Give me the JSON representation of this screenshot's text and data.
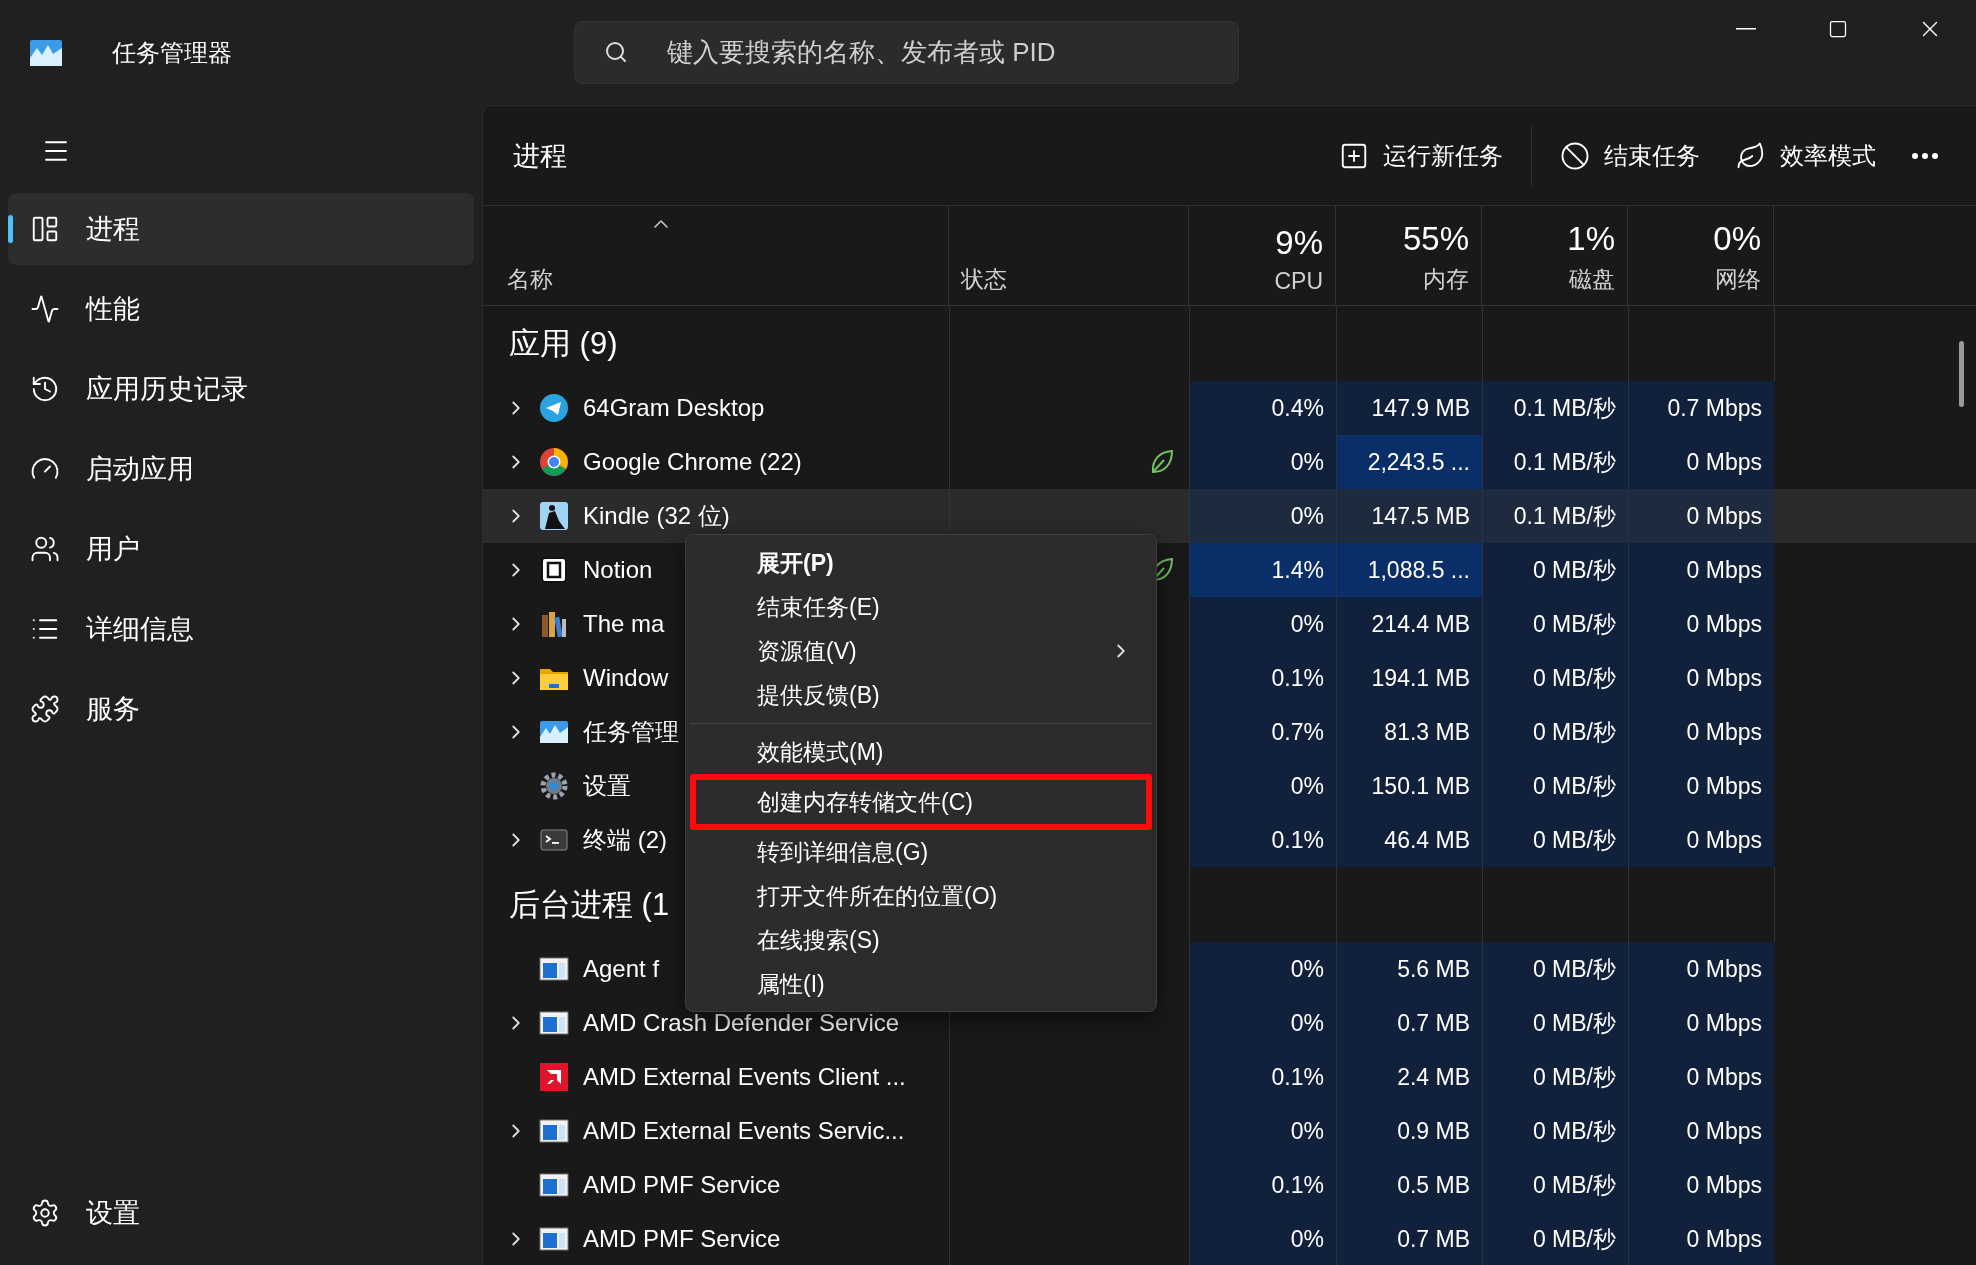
{
  "window": {
    "title": "任务管理器"
  },
  "search": {
    "placeholder": "键入要搜索的名称、发布者或 PID"
  },
  "sidebar": {
    "items": [
      {
        "label": "进程",
        "selected": true
      },
      {
        "label": "性能",
        "selected": false
      },
      {
        "label": "应用历史记录",
        "selected": false
      },
      {
        "label": "启动应用",
        "selected": false
      },
      {
        "label": "用户",
        "selected": false
      },
      {
        "label": "详细信息",
        "selected": false
      },
      {
        "label": "服务",
        "selected": false
      }
    ],
    "footer": {
      "label": "设置"
    }
  },
  "page": {
    "title": "进程",
    "actions": [
      {
        "label": "运行新任务"
      },
      {
        "label": "结束任务"
      },
      {
        "label": "效率模式"
      }
    ]
  },
  "table": {
    "name_column": {
      "label": "名称",
      "sorted": true
    },
    "status_column": {
      "label": "状态"
    },
    "metric_columns": [
      {
        "total": "9%",
        "label": "CPU"
      },
      {
        "total": "55%",
        "label": "内存"
      },
      {
        "total": "1%",
        "label": "磁盘"
      },
      {
        "total": "0%",
        "label": "网络"
      }
    ],
    "groups": [
      {
        "title": "应用 (9)",
        "rows": [
          {
            "name": "64Gram Desktop",
            "kind": "plane",
            "expandable": true,
            "efficiency": false,
            "hovered": false,
            "metrics": [
              {
                "value": "0.4%",
                "hot": false
              },
              {
                "value": "147.9 MB",
                "hot": false
              },
              {
                "value": "0.1 MB/秒",
                "hot": false
              },
              {
                "value": "0.7 Mbps",
                "hot": false
              }
            ]
          },
          {
            "name": "Google Chrome (22)",
            "kind": "wheel",
            "expandable": true,
            "efficiency": true,
            "hovered": false,
            "metrics": [
              {
                "value": "0%",
                "hot": false
              },
              {
                "value": "2,243.5 ...",
                "hot": true
              },
              {
                "value": "0.1 MB/秒",
                "hot": false
              },
              {
                "value": "0 Mbps",
                "hot": false
              }
            ]
          },
          {
            "name": "Kindle (32 位)",
            "kind": "reader",
            "expandable": true,
            "efficiency": false,
            "hovered": true,
            "metrics": [
              {
                "value": "0%",
                "hot": false
              },
              {
                "value": "147.5 MB",
                "hot": false
              },
              {
                "value": "0.1 MB/秒",
                "hot": false
              },
              {
                "value": "0 Mbps",
                "hot": false
              }
            ]
          },
          {
            "name": "Notion",
            "kind": "square",
            "expandable": true,
            "efficiency": true,
            "hovered": false,
            "metrics": [
              {
                "value": "1.4%",
                "hot": true
              },
              {
                "value": "1,088.5 ...",
                "hot": true
              },
              {
                "value": "0 MB/秒",
                "hot": false
              },
              {
                "value": "0 Mbps",
                "hot": false
              }
            ]
          },
          {
            "name": "The ma",
            "kind": "books",
            "expandable": true,
            "efficiency": false,
            "hovered": false,
            "metrics": [
              {
                "value": "0%",
                "hot": false
              },
              {
                "value": "214.4 MB",
                "hot": false
              },
              {
                "value": "0 MB/秒",
                "hot": false
              },
              {
                "value": "0 Mbps",
                "hot": false
              }
            ]
          },
          {
            "name": "Window",
            "kind": "folder",
            "expandable": true,
            "efficiency": false,
            "hovered": false,
            "metrics": [
              {
                "value": "0.1%",
                "hot": false
              },
              {
                "value": "194.1 MB",
                "hot": false
              },
              {
                "value": "0 MB/秒",
                "hot": false
              },
              {
                "value": "0 Mbps",
                "hot": false
              }
            ]
          },
          {
            "name": "任务管理",
            "kind": "chart",
            "expandable": true,
            "efficiency": false,
            "hovered": false,
            "metrics": [
              {
                "value": "0.7%",
                "hot": false
              },
              {
                "value": "81.3 MB",
                "hot": false
              },
              {
                "value": "0 MB/秒",
                "hot": false
              },
              {
                "value": "0 Mbps",
                "hot": false
              }
            ]
          },
          {
            "name": "设置",
            "kind": "gear",
            "expandable": false,
            "efficiency": false,
            "hovered": false,
            "metrics": [
              {
                "value": "0%",
                "hot": false
              },
              {
                "value": "150.1 MB",
                "hot": false
              },
              {
                "value": "0 MB/秒",
                "hot": false
              },
              {
                "value": "0 Mbps",
                "hot": false
              }
            ]
          },
          {
            "name": "终端 (2)",
            "kind": "terminal",
            "expandable": true,
            "efficiency": false,
            "hovered": false,
            "metrics": [
              {
                "value": "0.1%",
                "hot": false
              },
              {
                "value": "46.4 MB",
                "hot": false
              },
              {
                "value": "0 MB/秒",
                "hot": false
              },
              {
                "value": "0 Mbps",
                "hot": false
              }
            ]
          }
        ]
      },
      {
        "title": "后台进程 (1",
        "rows": [
          {
            "name": "Agent f",
            "kind": "window",
            "expandable": false,
            "efficiency": false,
            "hovered": false,
            "metrics": [
              {
                "value": "0%",
                "hot": false
              },
              {
                "value": "5.6 MB",
                "hot": false
              },
              {
                "value": "0 MB/秒",
                "hot": false
              },
              {
                "value": "0 Mbps",
                "hot": false
              }
            ]
          },
          {
            "name": "AMD Crash Defender Service",
            "kind": "window",
            "expandable": true,
            "efficiency": false,
            "hovered": false,
            "metrics": [
              {
                "value": "0%",
                "hot": false
              },
              {
                "value": "0.7 MB",
                "hot": false
              },
              {
                "value": "0 MB/秒",
                "hot": false
              },
              {
                "value": "0 Mbps",
                "hot": false
              }
            ]
          },
          {
            "name": "AMD External Events Client ...",
            "kind": "arrow",
            "expandable": false,
            "efficiency": false,
            "hovered": false,
            "metrics": [
              {
                "value": "0.1%",
                "hot": false
              },
              {
                "value": "2.4 MB",
                "hot": false
              },
              {
                "value": "0 MB/秒",
                "hot": false
              },
              {
                "value": "0 Mbps",
                "hot": false
              }
            ]
          },
          {
            "name": "AMD External Events Servic...",
            "kind": "window",
            "expandable": true,
            "efficiency": false,
            "hovered": false,
            "metrics": [
              {
                "value": "0%",
                "hot": false
              },
              {
                "value": "0.9 MB",
                "hot": false
              },
              {
                "value": "0 MB/秒",
                "hot": false
              },
              {
                "value": "0 Mbps",
                "hot": false
              }
            ]
          },
          {
            "name": "AMD PMF Service",
            "kind": "window",
            "expandable": false,
            "efficiency": false,
            "hovered": false,
            "metrics": [
              {
                "value": "0.1%",
                "hot": false
              },
              {
                "value": "0.5 MB",
                "hot": false
              },
              {
                "value": "0 MB/秒",
                "hot": false
              },
              {
                "value": "0 Mbps",
                "hot": false
              }
            ]
          },
          {
            "name": "AMD PMF Service",
            "kind": "window",
            "expandable": true,
            "efficiency": false,
            "hovered": false,
            "metrics": [
              {
                "value": "0%",
                "hot": false
              },
              {
                "value": "0.7 MB",
                "hot": false
              },
              {
                "value": "0 MB/秒",
                "hot": false
              },
              {
                "value": "0 Mbps",
                "hot": false
              }
            ]
          }
        ]
      }
    ]
  },
  "context_menu": {
    "items": [
      {
        "kind": "item",
        "label": "展开(P)",
        "default": true,
        "submenu": false,
        "marked": false
      },
      {
        "kind": "item",
        "label": "结束任务(E)",
        "default": false,
        "submenu": false,
        "marked": false
      },
      {
        "kind": "item",
        "label": "资源值(V)",
        "default": false,
        "submenu": true,
        "marked": false
      },
      {
        "kind": "item",
        "label": "提供反馈(B)",
        "default": false,
        "submenu": false,
        "marked": false
      },
      {
        "kind": "separator"
      },
      {
        "kind": "item",
        "label": "效能模式(M)",
        "default": false,
        "submenu": false,
        "marked": false
      },
      {
        "kind": "item",
        "label": "创建内存转储文件(C)",
        "default": false,
        "submenu": false,
        "marked": true
      },
      {
        "kind": "item",
        "label": "转到详细信息(G)",
        "default": false,
        "submenu": false,
        "marked": false
      },
      {
        "kind": "item",
        "label": "打开文件所在的位置(O)",
        "default": false,
        "submenu": false,
        "marked": false
      },
      {
        "kind": "item",
        "label": "在线搜索(S)",
        "default": false,
        "submenu": false,
        "marked": false
      },
      {
        "kind": "item",
        "label": "属性(I)",
        "default": false,
        "submenu": false,
        "marked": false
      }
    ]
  }
}
